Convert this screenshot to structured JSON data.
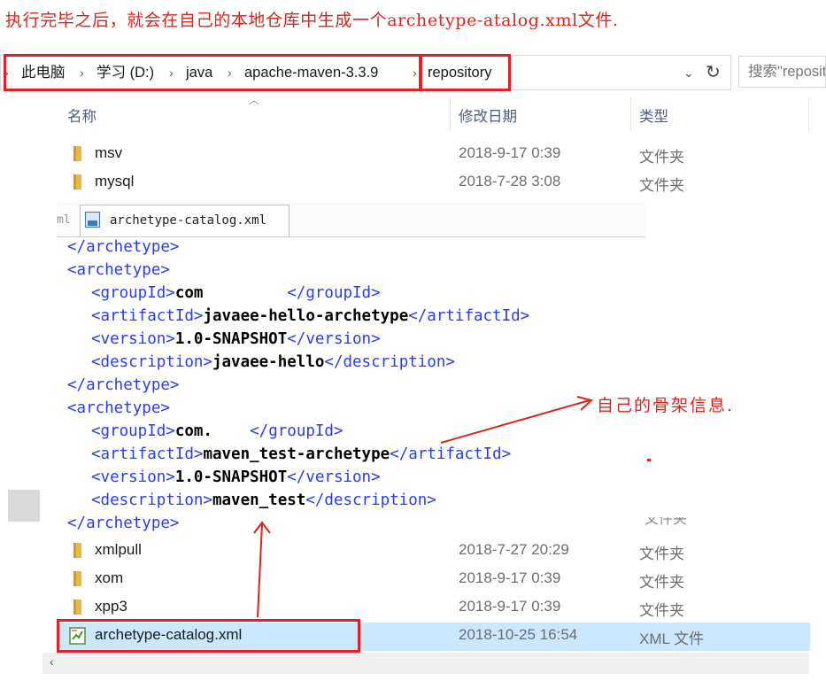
{
  "caption": "执行完毕之后，就会在自己的本地仓库中生成一个archetype-atalog.xml文件.",
  "address_bar": {
    "crumbs": [
      "此电脑",
      "学习 (D:)",
      "java",
      "apache-maven-3.3.9",
      "repository"
    ],
    "search_placeholder": "搜索\"repository\""
  },
  "columns": {
    "name": "名称",
    "date": "修改日期",
    "type": "类型"
  },
  "files_top": [
    {
      "name": "msv",
      "date": "2018-9-17 0:39",
      "type": "文件夹"
    },
    {
      "name": "mysql",
      "date": "2018-7-28 3:08",
      "type": "文件夹"
    }
  ],
  "files_bottom": [
    {
      "name": "xmlpull",
      "date": "2018-7-27 20:29",
      "type": "文件夹"
    },
    {
      "name": "xom",
      "date": "2018-9-17 0:39",
      "type": "文件夹"
    },
    {
      "name": "xpp3",
      "date": "2018-9-17 0:39",
      "type": "文件夹"
    },
    {
      "name": "archetype-catalog.xml",
      "date": "2018-10-25 16:54",
      "type": "XML 文件"
    }
  ],
  "partial_type_text": "文件夹",
  "editor": {
    "prev_tab_stub": "ml",
    "tab_label": "archetype-catalog.xml",
    "lines": {
      "l1": "</archetype>",
      "l2": "<archetype>",
      "l3_open": "<groupId>",
      "l3_val": "com",
      "l3_close": "</groupId>",
      "l4_open": "<artifactId>",
      "l4_val": "javaee-hello-archetype",
      "l4_close": "</artifactId>",
      "l5_open": "<version>",
      "l5_val": "1.0-SNAPSHOT",
      "l5_close": "</version>",
      "l6_open": "<description>",
      "l6_val": "javaee-hello",
      "l6_close": "</description>",
      "l7": "</archetype>",
      "l8": "<archetype>",
      "l9_open": "<groupId>",
      "l9_val": "com.",
      "l9_close": "</groupId>",
      "l10_open": "<artifactId>",
      "l10_val": "maven_test-archetype",
      "l10_close": "</artifactId>",
      "l11_open": "<version>",
      "l11_val": "1.0-SNAPSHOT",
      "l11_close": "</version>",
      "l12_open": "<description>",
      "l12_val": "maven_test",
      "l12_close": "</description>",
      "l13": "</archetype>"
    }
  },
  "annotation": "自己的骨架信息."
}
